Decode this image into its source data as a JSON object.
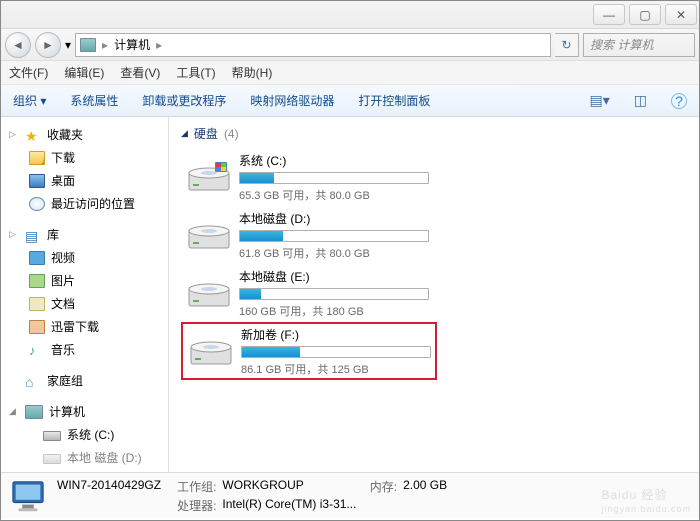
{
  "window": {
    "min": "—",
    "max": "▢",
    "close": "✕"
  },
  "nav": {
    "back": "◄",
    "fwd": "►",
    "dropdown": "▾",
    "path_item": "计算机",
    "sep1": "▸",
    "sep2": "▸",
    "refresh": "↻",
    "search_placeholder": "搜索 计算机",
    "search_icon": "🔍"
  },
  "menu": {
    "file": "文件(F)",
    "edit": "编辑(E)",
    "view": "查看(V)",
    "tools": "工具(T)",
    "help": "帮助(H)"
  },
  "toolbar": {
    "organize": "组织 ▾",
    "properties": "系统属性",
    "uninstall": "卸载或更改程序",
    "map": "映射网络驱动器",
    "cp": "打开控制面板",
    "view_icon": "▤▾",
    "pane_icon": "◫",
    "help_icon": "?"
  },
  "sidebar": {
    "favorites": {
      "label": "收藏夹",
      "tw": "▷"
    },
    "downloads": "下载",
    "desktop": "桌面",
    "recent": "最近访问的位置",
    "libraries": {
      "label": "库",
      "tw": "▷"
    },
    "videos": "视频",
    "pictures": "图片",
    "documents": "文档",
    "xunlei": "迅雷下载",
    "music": "音乐",
    "homegroup": "家庭组",
    "computer": {
      "label": "计算机",
      "tw": "◢"
    },
    "drive_c": "系统 (C:)",
    "drive_d_cut": "本地 磁盘 (D:)"
  },
  "content": {
    "category": "硬盘",
    "count": "(4)",
    "tw": "◢",
    "drives": [
      {
        "name": "系统 (C:)",
        "free": "65.3 GB 可用，共 80.0 GB",
        "pct": 18,
        "highlight": false,
        "win": true
      },
      {
        "name": "本地磁盘 (D:)",
        "free": "61.8 GB 可用，共 80.0 GB",
        "pct": 23,
        "highlight": false,
        "win": false
      },
      {
        "name": "本地磁盘 (E:)",
        "free": "160 GB 可用，共 180 GB",
        "pct": 11,
        "highlight": false,
        "win": false
      },
      {
        "name": "新加卷 (F:)",
        "free": "86.1 GB 可用，共 125 GB",
        "pct": 31,
        "highlight": true,
        "win": false
      }
    ]
  },
  "status": {
    "name": "WIN7-20140429GZ",
    "wg_label": "工作组:",
    "wg": "WORKGROUP",
    "cpu_label": "处理器:",
    "cpu": "Intel(R) Core(TM) i3-31...",
    "mem_label": "内存:",
    "mem": "2.00 GB"
  },
  "watermark": {
    "brand": "Baidu 经验",
    "sub": "jingyan.baidu.com"
  }
}
